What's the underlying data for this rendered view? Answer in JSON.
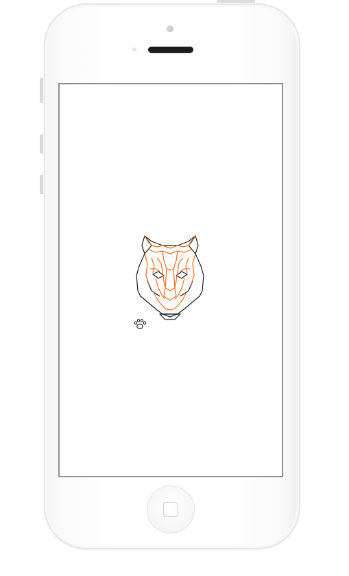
{
  "device": {
    "model": "white-smartphone",
    "body_color": "#ffffff",
    "screen_border_color": "#8e8e8e",
    "speaker_color": "#1d1d1d"
  },
  "screen": {
    "background": "#ffffff",
    "content": {
      "logo": {
        "icon": "tiger-head-icon",
        "stroke_primary": "#f26a1b",
        "stroke_secondary": "#1a1a1a"
      },
      "badge": {
        "icon": "paw-print-icon",
        "color": "#1a1a1a"
      }
    }
  },
  "hardware_buttons": {
    "home": "home-button",
    "side": [
      "mute-switch",
      "volume-up-button",
      "volume-down-button"
    ],
    "top": "power-button"
  }
}
